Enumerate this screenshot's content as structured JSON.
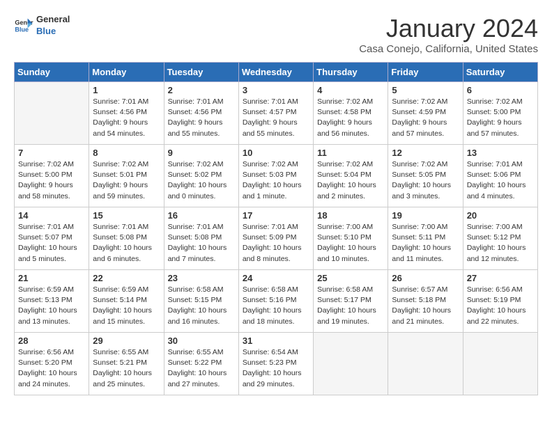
{
  "logo": {
    "line1": "General",
    "line2": "Blue"
  },
  "title": "January 2024",
  "subtitle": "Casa Conejo, California, United States",
  "days_of_week": [
    "Sunday",
    "Monday",
    "Tuesday",
    "Wednesday",
    "Thursday",
    "Friday",
    "Saturday"
  ],
  "weeks": [
    [
      {
        "day": "",
        "info": ""
      },
      {
        "day": "1",
        "info": "Sunrise: 7:01 AM\nSunset: 4:56 PM\nDaylight: 9 hours\nand 54 minutes."
      },
      {
        "day": "2",
        "info": "Sunrise: 7:01 AM\nSunset: 4:56 PM\nDaylight: 9 hours\nand 55 minutes."
      },
      {
        "day": "3",
        "info": "Sunrise: 7:01 AM\nSunset: 4:57 PM\nDaylight: 9 hours\nand 55 minutes."
      },
      {
        "day": "4",
        "info": "Sunrise: 7:02 AM\nSunset: 4:58 PM\nDaylight: 9 hours\nand 56 minutes."
      },
      {
        "day": "5",
        "info": "Sunrise: 7:02 AM\nSunset: 4:59 PM\nDaylight: 9 hours\nand 57 minutes."
      },
      {
        "day": "6",
        "info": "Sunrise: 7:02 AM\nSunset: 5:00 PM\nDaylight: 9 hours\nand 57 minutes."
      }
    ],
    [
      {
        "day": "7",
        "info": "Sunrise: 7:02 AM\nSunset: 5:00 PM\nDaylight: 9 hours\nand 58 minutes."
      },
      {
        "day": "8",
        "info": "Sunrise: 7:02 AM\nSunset: 5:01 PM\nDaylight: 9 hours\nand 59 minutes."
      },
      {
        "day": "9",
        "info": "Sunrise: 7:02 AM\nSunset: 5:02 PM\nDaylight: 10 hours\nand 0 minutes."
      },
      {
        "day": "10",
        "info": "Sunrise: 7:02 AM\nSunset: 5:03 PM\nDaylight: 10 hours\nand 1 minute."
      },
      {
        "day": "11",
        "info": "Sunrise: 7:02 AM\nSunset: 5:04 PM\nDaylight: 10 hours\nand 2 minutes."
      },
      {
        "day": "12",
        "info": "Sunrise: 7:02 AM\nSunset: 5:05 PM\nDaylight: 10 hours\nand 3 minutes."
      },
      {
        "day": "13",
        "info": "Sunrise: 7:01 AM\nSunset: 5:06 PM\nDaylight: 10 hours\nand 4 minutes."
      }
    ],
    [
      {
        "day": "14",
        "info": "Sunrise: 7:01 AM\nSunset: 5:07 PM\nDaylight: 10 hours\nand 5 minutes."
      },
      {
        "day": "15",
        "info": "Sunrise: 7:01 AM\nSunset: 5:08 PM\nDaylight: 10 hours\nand 6 minutes."
      },
      {
        "day": "16",
        "info": "Sunrise: 7:01 AM\nSunset: 5:08 PM\nDaylight: 10 hours\nand 7 minutes."
      },
      {
        "day": "17",
        "info": "Sunrise: 7:01 AM\nSunset: 5:09 PM\nDaylight: 10 hours\nand 8 minutes."
      },
      {
        "day": "18",
        "info": "Sunrise: 7:00 AM\nSunset: 5:10 PM\nDaylight: 10 hours\nand 10 minutes."
      },
      {
        "day": "19",
        "info": "Sunrise: 7:00 AM\nSunset: 5:11 PM\nDaylight: 10 hours\nand 11 minutes."
      },
      {
        "day": "20",
        "info": "Sunrise: 7:00 AM\nSunset: 5:12 PM\nDaylight: 10 hours\nand 12 minutes."
      }
    ],
    [
      {
        "day": "21",
        "info": "Sunrise: 6:59 AM\nSunset: 5:13 PM\nDaylight: 10 hours\nand 13 minutes."
      },
      {
        "day": "22",
        "info": "Sunrise: 6:59 AM\nSunset: 5:14 PM\nDaylight: 10 hours\nand 15 minutes."
      },
      {
        "day": "23",
        "info": "Sunrise: 6:58 AM\nSunset: 5:15 PM\nDaylight: 10 hours\nand 16 minutes."
      },
      {
        "day": "24",
        "info": "Sunrise: 6:58 AM\nSunset: 5:16 PM\nDaylight: 10 hours\nand 18 minutes."
      },
      {
        "day": "25",
        "info": "Sunrise: 6:58 AM\nSunset: 5:17 PM\nDaylight: 10 hours\nand 19 minutes."
      },
      {
        "day": "26",
        "info": "Sunrise: 6:57 AM\nSunset: 5:18 PM\nDaylight: 10 hours\nand 21 minutes."
      },
      {
        "day": "27",
        "info": "Sunrise: 6:56 AM\nSunset: 5:19 PM\nDaylight: 10 hours\nand 22 minutes."
      }
    ],
    [
      {
        "day": "28",
        "info": "Sunrise: 6:56 AM\nSunset: 5:20 PM\nDaylight: 10 hours\nand 24 minutes."
      },
      {
        "day": "29",
        "info": "Sunrise: 6:55 AM\nSunset: 5:21 PM\nDaylight: 10 hours\nand 25 minutes."
      },
      {
        "day": "30",
        "info": "Sunrise: 6:55 AM\nSunset: 5:22 PM\nDaylight: 10 hours\nand 27 minutes."
      },
      {
        "day": "31",
        "info": "Sunrise: 6:54 AM\nSunset: 5:23 PM\nDaylight: 10 hours\nand 29 minutes."
      },
      {
        "day": "",
        "info": ""
      },
      {
        "day": "",
        "info": ""
      },
      {
        "day": "",
        "info": ""
      }
    ]
  ]
}
